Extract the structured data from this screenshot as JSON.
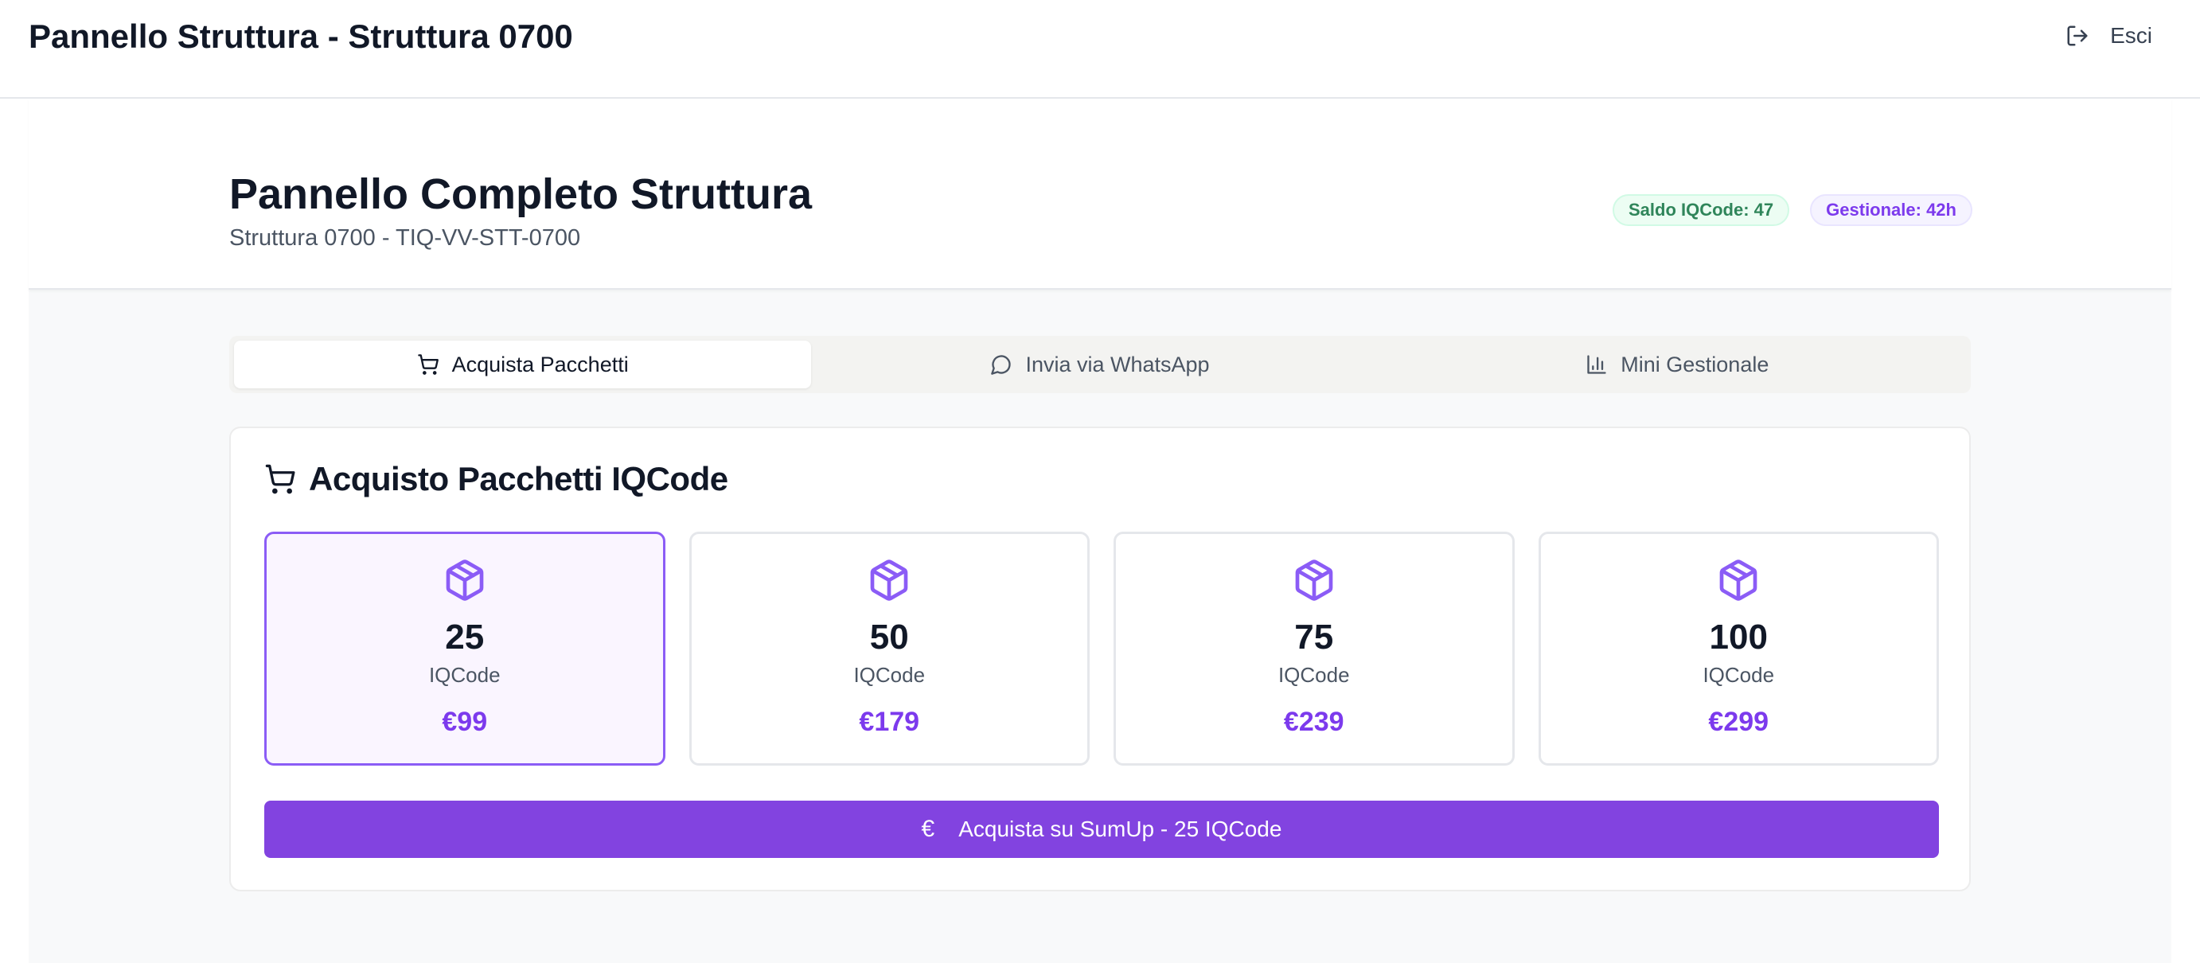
{
  "header": {
    "title": "Pannello Struttura - Struttura 0700",
    "logout_label": "Esci"
  },
  "structure": {
    "title": "Pannello Completo Struttura",
    "subtitle": "Struttura 0700 - TIQ-VV-STT-0700",
    "badges": [
      {
        "label": "Saldo IQCode: 47",
        "color": "#2f855a"
      },
      {
        "label": "Gestionale: 42h",
        "color": "#7c3aed"
      }
    ]
  },
  "tabs": [
    {
      "label": "Acquista Pacchetti",
      "icon": "cart-icon",
      "active": true
    },
    {
      "label": "Invia via WhatsApp",
      "icon": "message-circle-icon",
      "active": false
    },
    {
      "label": "Mini Gestionale",
      "icon": "bar-chart-icon",
      "active": false
    }
  ],
  "purchase": {
    "title": "Acquisto Pacchetti IQCode",
    "packages": [
      {
        "qty": "25",
        "unit": "IQCode",
        "price": "€99",
        "selected": true
      },
      {
        "qty": "50",
        "unit": "IQCode",
        "price": "€179",
        "selected": false
      },
      {
        "qty": "75",
        "unit": "IQCode",
        "price": "€239",
        "selected": false
      },
      {
        "qty": "100",
        "unit": "IQCode",
        "price": "€299",
        "selected": false
      }
    ],
    "button_icon": "€",
    "button_label": "Acquista su SumUp - 25 IQCode"
  },
  "colors": {
    "accent": "#8243e0",
    "accent_text": "#7c3aed",
    "success": "#2f855a"
  }
}
